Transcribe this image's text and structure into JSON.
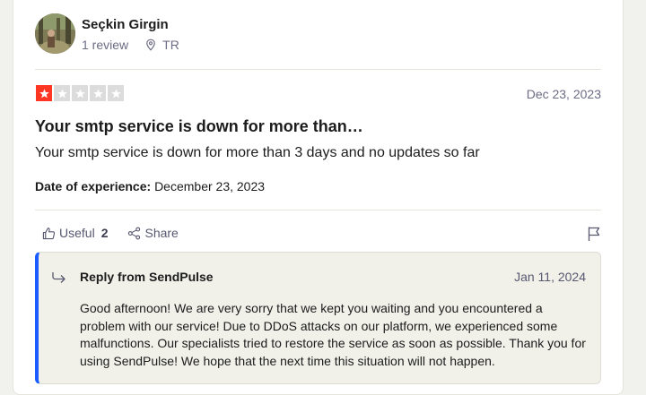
{
  "reviewer": {
    "name": "Seçkin Girgin",
    "review_count": "1 review",
    "country": "TR"
  },
  "review": {
    "rating": 1,
    "rating_max": 5,
    "date": "Dec 23, 2023",
    "title": "Your smtp service is down for more than…",
    "body": "Your smtp service is down for more than 3 days and no updates so far",
    "experience_label": "Date of experience:",
    "experience_date": "December 23, 2023"
  },
  "actions": {
    "useful_label": "Useful",
    "useful_count": "2",
    "share_label": "Share"
  },
  "reply": {
    "from": "Reply from SendPulse",
    "date": "Jan 11, 2024",
    "body": "Good afternoon! We are very sorry that we kept you waiting and you encountered a problem with our service! Due to DDoS attacks on our platform, we experienced some malfunctions. Our specialists tried to restore the service as soon as possible. Thank you for using SendPulse! We hope that the next time this situation will not happen."
  },
  "icons": {
    "location": "location-pin-icon",
    "useful": "thumbs-up-icon",
    "share": "share-icon",
    "flag": "flag-icon",
    "reply": "reply-arrow-icon",
    "star": "star-icon"
  },
  "colors": {
    "star_filled": "#ff3722",
    "star_empty": "#dcdcdc",
    "reply_accent": "#1a5cff",
    "reply_background": "#f1f1ea"
  }
}
